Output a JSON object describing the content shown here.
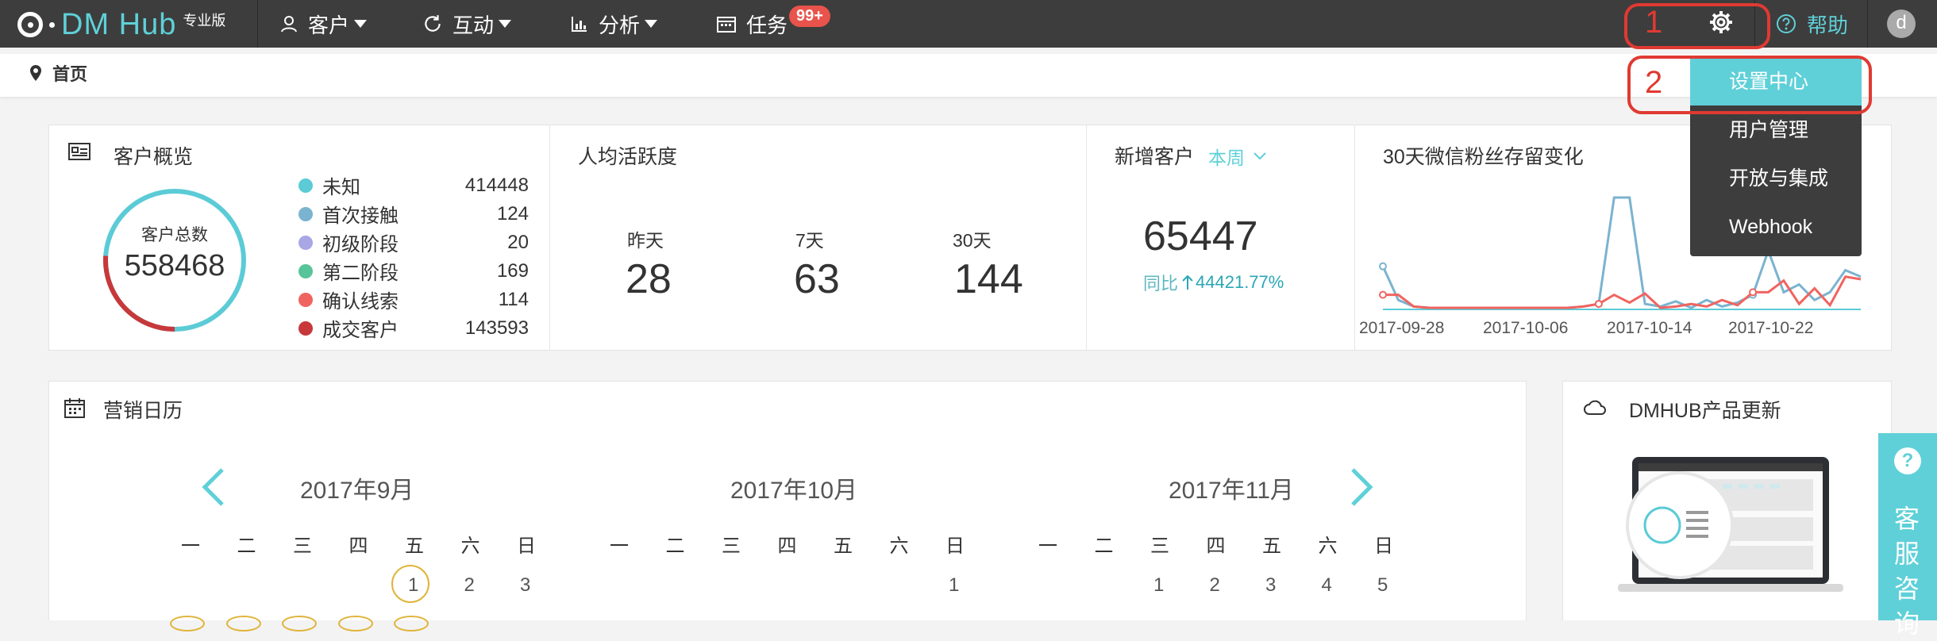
{
  "topbar": {
    "logo_text": "DM Hub",
    "logo_sup": "专业版",
    "nav": [
      {
        "label": "客户",
        "icon": "user-icon"
      },
      {
        "label": "互动",
        "icon": "refresh-icon"
      },
      {
        "label": "分析",
        "icon": "bar-chart-icon"
      },
      {
        "label": "任务",
        "icon": "calendar-icon",
        "badge": "99+"
      }
    ],
    "help_label": "帮助",
    "avatar_letter": "d",
    "annotation_1": "1",
    "annotation_2": "2"
  },
  "breadcrumb": {
    "home": "首页"
  },
  "settings_menu": {
    "items": [
      "设置中心",
      "用户管理",
      "开放与集成",
      "Webhook"
    ],
    "active_index": 0
  },
  "overview": {
    "title": "客户概览",
    "total_label": "客户总数",
    "total_value": "558468",
    "legend": [
      {
        "label": "未知",
        "value": "414448",
        "color": "#5bcbd6"
      },
      {
        "label": "首次接触",
        "value": "124",
        "color": "#7ab3cf"
      },
      {
        "label": "初级阶段",
        "value": "20",
        "color": "#a9a6e6"
      },
      {
        "label": "第二阶段",
        "value": "169",
        "color": "#58c49a"
      },
      {
        "label": "确认线索",
        "value": "114",
        "color": "#f06460"
      },
      {
        "label": "成交客户",
        "value": "143593",
        "color": "#c7383a"
      }
    ],
    "ring_red_fraction": 0.26
  },
  "activity": {
    "title": "人均活跃度",
    "stats": [
      {
        "label": "昨天",
        "value": "28"
      },
      {
        "label": "7天",
        "value": "63"
      },
      {
        "label": "30天",
        "value": "144"
      }
    ]
  },
  "new_customers": {
    "title": "新增客户",
    "period": "本周",
    "value": "65447",
    "compare_label": "同比",
    "compare_value": "44421.77%"
  },
  "retention": {
    "title": "30天微信粉丝存留变化"
  },
  "chart_data": {
    "type": "line",
    "title": "30天微信粉丝存留变化",
    "x_tick_labels": [
      "2017-09-28",
      "2017-10-06",
      "2017-10-14",
      "2017-10-22"
    ],
    "series": [
      {
        "color": "#7ab3cf",
        "values": [
          3.2,
          0.6,
          0.1,
          0,
          0,
          0,
          0,
          0,
          0,
          0,
          0,
          0,
          0,
          0.1,
          0.3,
          8.5,
          8.5,
          0.3,
          0.1,
          0.5,
          0,
          0.6,
          0.1,
          0.4,
          1.0,
          4.4,
          1.2,
          1.8,
          0.6,
          1.2,
          2.9,
          2.4
        ]
      },
      {
        "color": "#f06460",
        "values": [
          1.0,
          1.0,
          0.1,
          0,
          0,
          0,
          0,
          0,
          0,
          0,
          0,
          0,
          0,
          0.1,
          0.3,
          1.0,
          0.4,
          1.1,
          0,
          0.1,
          0.3,
          0.1,
          0.6,
          0.2,
          1.2,
          1.2,
          2.1,
          0.3,
          1.5,
          0.2,
          2.4,
          2.2
        ]
      }
    ]
  },
  "calendar": {
    "title": "营销日历",
    "months": [
      "2017年9月",
      "2017年10月",
      "2017年11月"
    ],
    "weekdays": [
      "一",
      "二",
      "三",
      "四",
      "五",
      "六",
      "日"
    ],
    "sep_days": [
      "1",
      "2",
      "3"
    ],
    "oct_days": [
      "1"
    ],
    "nov_days": [
      "1",
      "2",
      "3",
      "4",
      "5"
    ]
  },
  "updates": {
    "title": "DMHUB产品更新"
  },
  "service": {
    "label": "客服咨询"
  },
  "colors": {
    "accent": "#5fd0d8",
    "topbar": "#3d3d3d",
    "annotation": "#e03a32"
  }
}
